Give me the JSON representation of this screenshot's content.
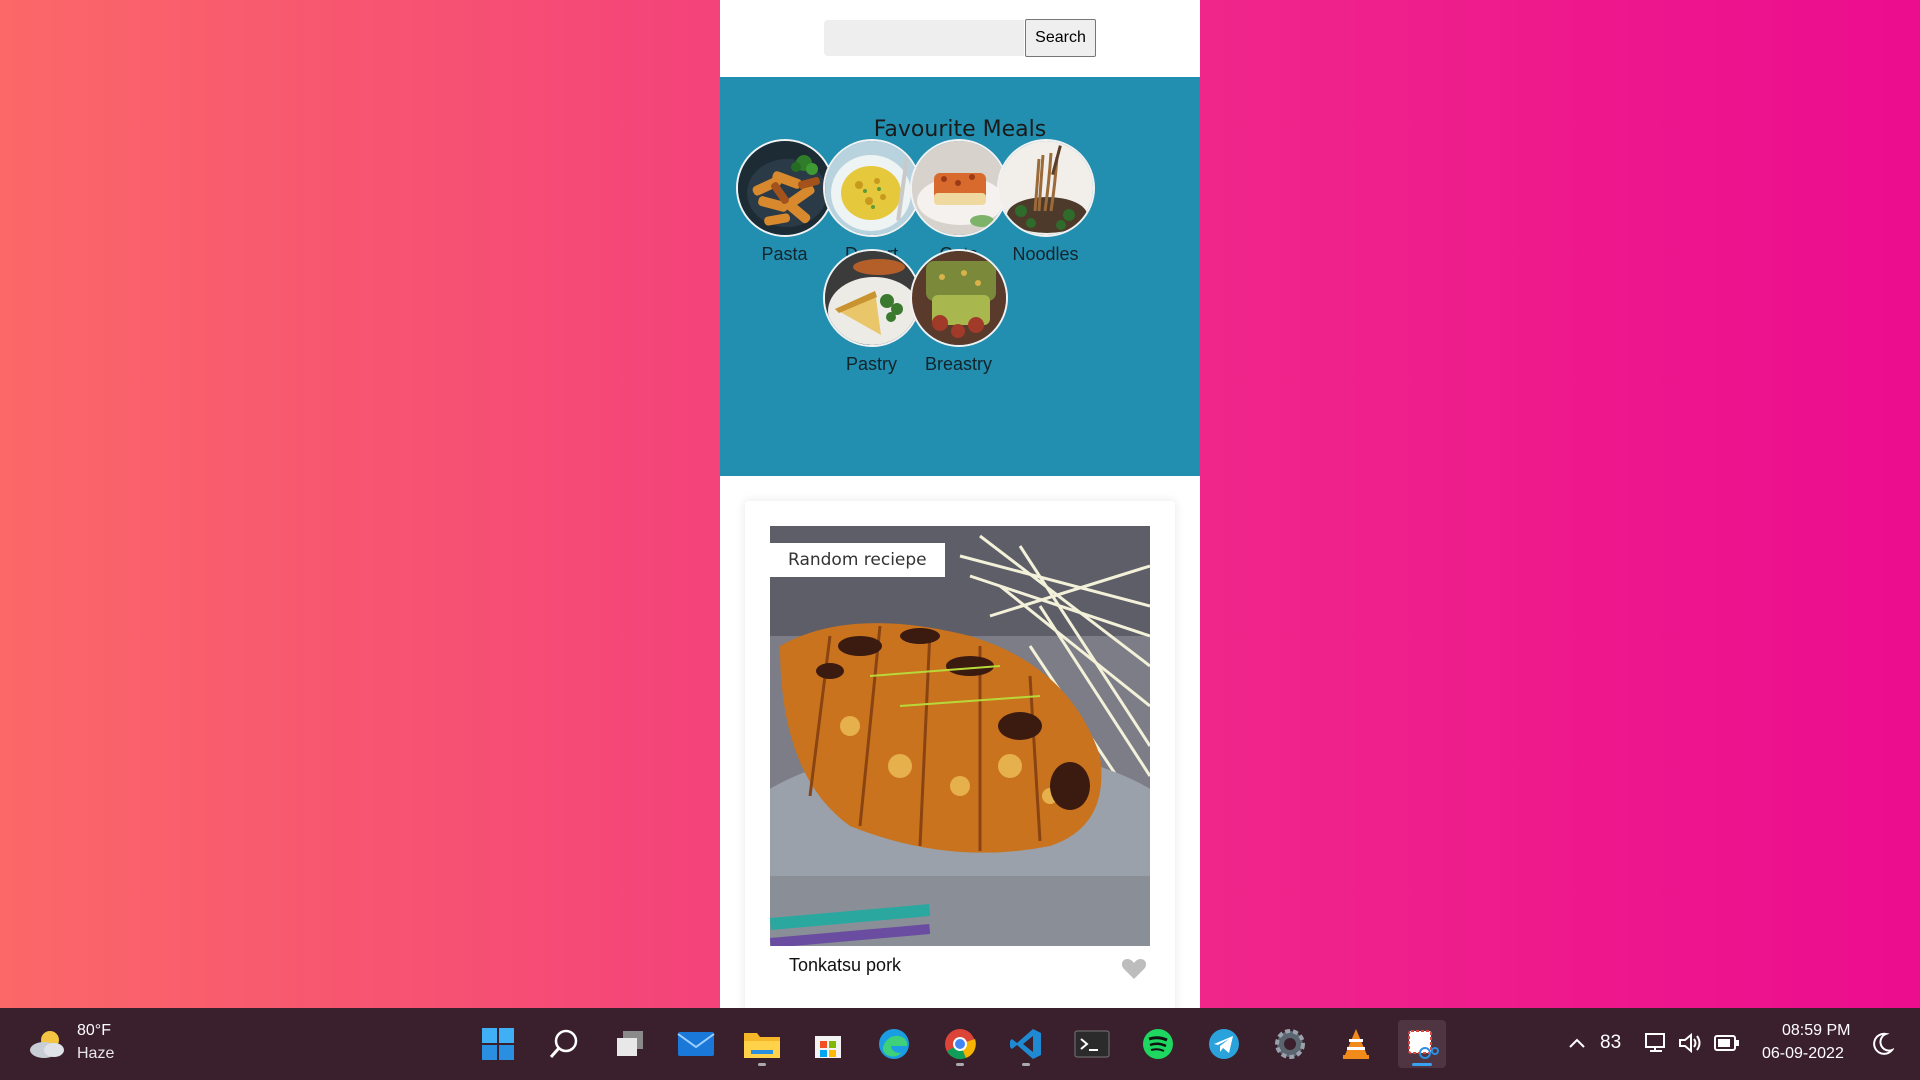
{
  "search": {
    "placeholder": "",
    "value": "",
    "button_label": "Search"
  },
  "favourites": {
    "title": "Favourite Meals",
    "meals": [
      {
        "label": "Pasta"
      },
      {
        "label": "Desert"
      },
      {
        "label": "Oats"
      },
      {
        "label": "Noodles"
      },
      {
        "label": "Pastry"
      },
      {
        "label": "Breastry"
      }
    ]
  },
  "recipe": {
    "tag": "Random reciepe",
    "name": "Tonkatsu pork",
    "favourite_icon": "heart-icon"
  },
  "taskbar": {
    "weather": {
      "temp": "80°F",
      "condition": "Haze",
      "icon": "partly-cloudy-icon"
    },
    "apps": [
      {
        "name": "start-icon"
      },
      {
        "name": "search-icon"
      },
      {
        "name": "task-view-icon"
      },
      {
        "name": "mail-icon"
      },
      {
        "name": "file-explorer-icon"
      },
      {
        "name": "microsoft-store-icon"
      },
      {
        "name": "edge-icon"
      },
      {
        "name": "chrome-icon"
      },
      {
        "name": "vscode-icon"
      },
      {
        "name": "terminal-icon"
      },
      {
        "name": "spotify-icon"
      },
      {
        "name": "telegram-icon"
      },
      {
        "name": "settings-icon"
      },
      {
        "name": "vlc-icon"
      },
      {
        "name": "snipping-tool-icon"
      }
    ],
    "tray": {
      "badge": "83",
      "time": "08:59 PM",
      "date": "06-09-2022"
    }
  },
  "colors": {
    "fav_bg": "#238fb0",
    "taskbar_bg": "#3a1f2c",
    "gradient_start": "#fb6868",
    "gradient_end": "#ec0c8e"
  }
}
